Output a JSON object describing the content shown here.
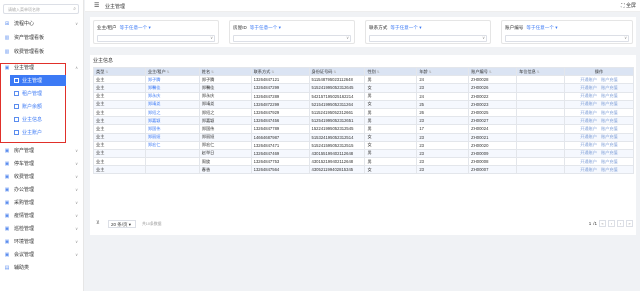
{
  "sidebar": {
    "search_placeholder": "请输入菜单项名称",
    "items": [
      {
        "label": "流程中心",
        "icon": "flow-icon"
      },
      {
        "label": "资产管理看板",
        "icon": "chart-icon"
      },
      {
        "label": "收费管理看板",
        "icon": "chart-icon"
      },
      {
        "label": "业主管理",
        "icon": "folder-icon"
      },
      {
        "label": "房产管理",
        "icon": "folder-icon"
      },
      {
        "label": "停车管理",
        "icon": "folder-icon"
      },
      {
        "label": "收费管理",
        "icon": "folder-icon"
      },
      {
        "label": "办公管理",
        "icon": "folder-icon"
      },
      {
        "label": "采购管理",
        "icon": "folder-icon"
      },
      {
        "label": "疫情管理",
        "icon": "folder-icon"
      },
      {
        "label": "巡检管理",
        "icon": "folder-icon"
      },
      {
        "label": "环境管理",
        "icon": "folder-icon"
      },
      {
        "label": "会议管理",
        "icon": "folder-icon"
      },
      {
        "label": "辅助类",
        "icon": "doc-icon"
      }
    ],
    "sub_items": [
      {
        "label": "业主管理"
      },
      {
        "label": "租户管理"
      },
      {
        "label": "账户余额"
      },
      {
        "label": "业主信息"
      },
      {
        "label": "业主账户"
      }
    ]
  },
  "header": {
    "title": "业主管理",
    "fullscreen": "全屏"
  },
  "filters": [
    {
      "label": "业主/租户",
      "pick": "等于任意一个 ▾"
    },
    {
      "label": "房屋ID",
      "pick": "等于任意一个 ▾"
    },
    {
      "label": "联系方式",
      "pick": "等于任意一个 ▾"
    },
    {
      "label": "账户编号",
      "pick": "等于任意一个 ▾"
    }
  ],
  "table": {
    "title": "业主信息",
    "columns": [
      "类型",
      "业主/租户",
      "姓名",
      "联系方式",
      "身份证号码",
      "性别",
      "年龄",
      "账户编号",
      "车位信息",
      "操作"
    ],
    "op_labels": [
      "开通账户",
      "账户充值"
    ],
    "rows": [
      [
        "业主",
        "郑子腾",
        "郑子腾",
        "13264847121",
        "511548795023112648",
        "男",
        "24",
        "ZH00028",
        ""
      ],
      [
        "业主",
        "郑馨佳",
        "郑馨佳",
        "13264847299",
        "515241995052312645",
        "女",
        "23",
        "ZH00026",
        ""
      ],
      [
        "业主",
        "郑永庆",
        "郑永庆",
        "13264847289",
        "542157195025162214",
        "男",
        "24",
        "ZH00022",
        ""
      ],
      [
        "业主",
        "郑靖尧",
        "郑靖尧",
        "13264872299",
        "521541995052311264",
        "女",
        "25",
        "ZH00023",
        ""
      ],
      [
        "业主",
        "郑绍之",
        "郑绍之",
        "13264847929",
        "511524195052312661",
        "男",
        "26",
        "ZH00025",
        ""
      ],
      [
        "业主",
        "郑嘉颖",
        "郑嘉颖",
        "13264847456",
        "512541995052312651",
        "男",
        "23",
        "ZH00027",
        ""
      ],
      [
        "业主",
        "郑国伟",
        "郑国伟",
        "13264847789",
        "152241995052312545",
        "男",
        "17",
        "ZH00024",
        ""
      ],
      [
        "业主",
        "郑丽娅",
        "郑丽娅",
        "14664687987",
        "515324195052312514",
        "女",
        "23",
        "ZH00021",
        ""
      ],
      [
        "业主",
        "郑宏仁",
        "郑宏仁",
        "13264847471",
        "515241595052312515",
        "女",
        "23",
        "ZH00020",
        ""
      ],
      [
        "业主",
        "",
        "赵举日",
        "13264847469",
        "430155199402112648",
        "男",
        "23",
        "ZH00009",
        ""
      ],
      [
        "业主",
        "",
        "周旋",
        "13264847753",
        "430152199402112648",
        "男",
        "23",
        "ZH00008",
        ""
      ],
      [
        "业主",
        "",
        "春香",
        "13264847564",
        "430521199402815345",
        "女",
        "23",
        "ZH00007",
        ""
      ]
    ]
  },
  "footer": {
    "page_size": "20 条/页 ▾",
    "total": "共10条数据",
    "page": "1",
    "page_total": "/1"
  }
}
